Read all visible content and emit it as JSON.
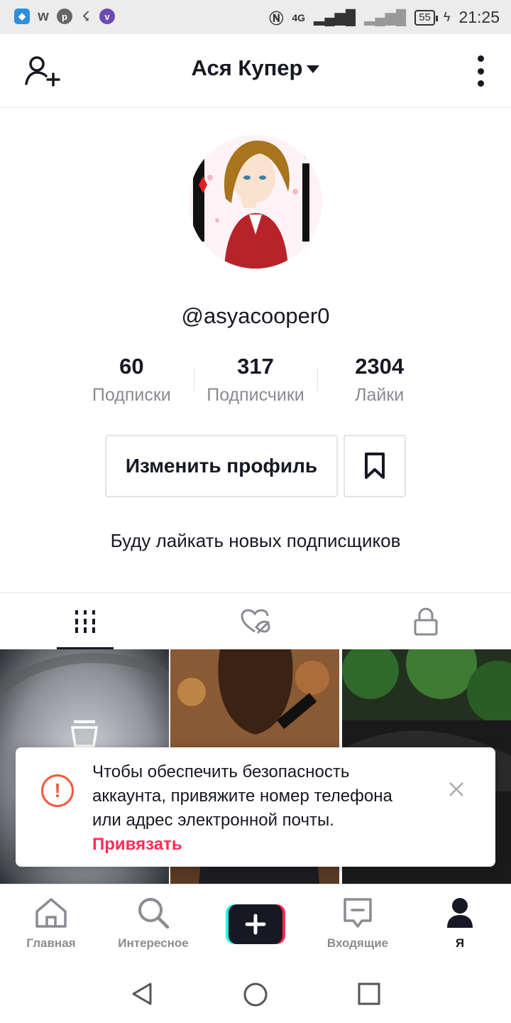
{
  "status_bar": {
    "time": "21:25",
    "battery": "55",
    "network": "4G"
  },
  "header": {
    "title": "Ася Купер"
  },
  "profile": {
    "handle": "@asyacooper0",
    "stats": [
      {
        "value": "60",
        "label": "Подписки"
      },
      {
        "value": "317",
        "label": "Подписчики"
      },
      {
        "value": "2304",
        "label": "Лайки"
      }
    ],
    "edit_button": "Изменить профиль",
    "bio": "Буду лайкать новых подписщиков"
  },
  "toast": {
    "message": "Чтобы обеспечить безопасность аккаунта, привяжите номер телефона или адрес электронной почты.",
    "link": "Привязать"
  },
  "bottom_nav": {
    "items": [
      {
        "label": "Главная",
        "icon": "home-icon"
      },
      {
        "label": "Интересное",
        "icon": "search-icon"
      },
      {
        "label": "Входящие",
        "icon": "inbox-icon"
      },
      {
        "label": "Я",
        "icon": "profile-icon"
      }
    ]
  },
  "colors": {
    "accent": "#fe2c55",
    "warning": "#f15a3b",
    "text": "#161823",
    "muted": "#8a8b91"
  }
}
